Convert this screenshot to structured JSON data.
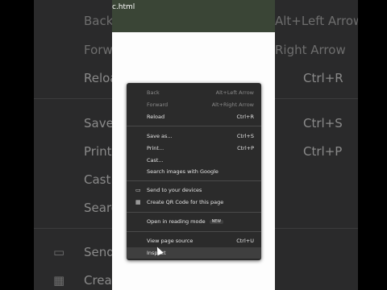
{
  "url_fragment": "c.html",
  "menu": {
    "back": {
      "label": "Back",
      "shortcut": "Alt+Left Arrow"
    },
    "forward": {
      "label": "Forward",
      "shortcut": "Alt+Right Arrow"
    },
    "reload": {
      "label": "Reload",
      "shortcut": "Ctrl+R"
    },
    "save_as": {
      "label": "Save as...",
      "shortcut": "Ctrl+S"
    },
    "print": {
      "label": "Print...",
      "shortcut": "Ctrl+P"
    },
    "cast": {
      "label": "Cast..."
    },
    "search_images": {
      "label": "Search images with Google"
    },
    "send_devices": {
      "label": "Send to your devices"
    },
    "qr_code": {
      "label": "Create QR Code for this page"
    },
    "reading_mode": {
      "label": "Open in reading mode",
      "badge": "NEW"
    },
    "view_source": {
      "label": "View page source",
      "shortcut": "Ctrl+U"
    },
    "inspect": {
      "label": "Inspect"
    }
  },
  "background_menu": {
    "back": "Back",
    "back_sc": "Alt+Left Arrow",
    "forward": "Forwa",
    "forward_sc": "Right Arrow",
    "reload": "Reload",
    "reload_sc": "Ctrl+R",
    "save": "Save",
    "save_sc": "Ctrl+S",
    "print": "Print",
    "print_sc": "Ctrl+P",
    "cast": "Cast.",
    "search": "Searc",
    "send": "Send",
    "create": "Creat"
  }
}
